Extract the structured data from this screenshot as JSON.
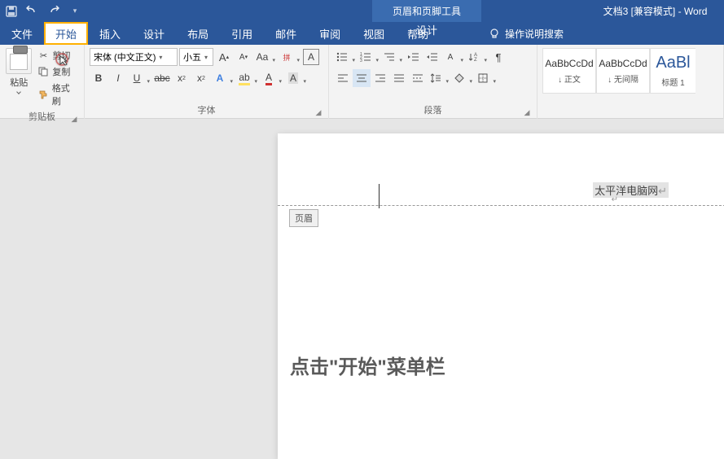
{
  "titlebar": {
    "doc_title": "文档3 [兼容模式] - Word",
    "contextual_title": "页眉和页脚工具"
  },
  "tabs": {
    "file": "文件",
    "home": "开始",
    "insert": "插入",
    "design": "设计",
    "layout": "布局",
    "references": "引用",
    "mailings": "邮件",
    "review": "审阅",
    "view": "视图",
    "help": "帮助",
    "context_design": "设计",
    "tell_me": "操作说明搜索"
  },
  "clipboard": {
    "paste": "粘贴",
    "cut": "剪切",
    "copy": "复制",
    "format_painter": "格式刷",
    "group_label": "剪贴板"
  },
  "font": {
    "font_name": "宋体 (中文正文)",
    "font_size": "小五",
    "group_label": "字体"
  },
  "paragraph": {
    "group_label": "段落"
  },
  "styles": {
    "preview": "AaBbCcDd",
    "preview_big": "AaBl",
    "s1": "↓ 正文",
    "s2": "↓ 无间隔",
    "s3": "标题 1"
  },
  "document": {
    "header_text": "太平洋电脑网",
    "header_tag": "页眉"
  },
  "overlay": "点击\"开始\"菜单栏"
}
